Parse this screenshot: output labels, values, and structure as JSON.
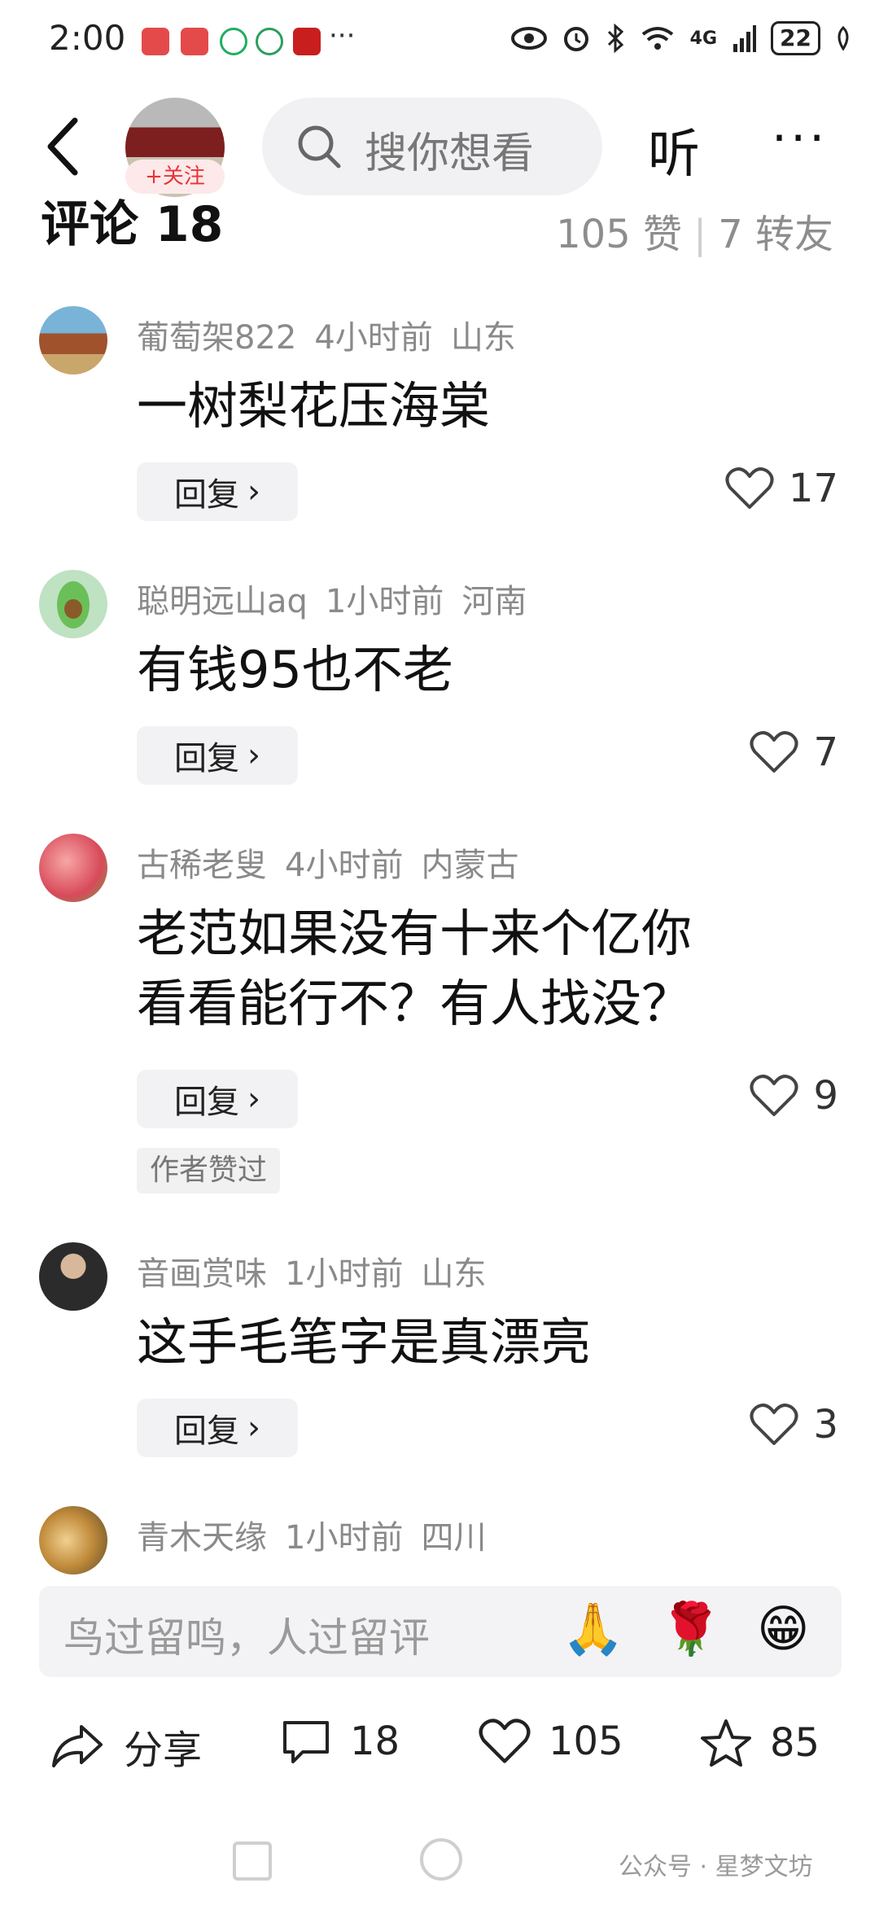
{
  "status_bar": {
    "time": "2:00",
    "network": "4G",
    "battery": "22",
    "icons": [
      "huawei-app-icon",
      "huawei-app-icon",
      "green-app-icon",
      "chat-app-icon",
      "study-app-icon",
      "more-dots-icon",
      "eye-icon",
      "alarm-icon",
      "bluetooth-icon",
      "wifi-icon",
      "signal-icon",
      "leaf-icon"
    ]
  },
  "top_nav": {
    "follow_label": "+关注",
    "search_placeholder": "搜你想看",
    "listen_label": "听",
    "more_label": "···"
  },
  "comments_header": {
    "title": "评论 18",
    "likes": "105 赞",
    "shares": "7 转友"
  },
  "comments": [
    {
      "user": "葡萄架822",
      "time": "4小时前",
      "location": "山东",
      "text": "一树梨花压海棠",
      "likes": "17",
      "reply": "回复"
    },
    {
      "user": "聪明远山aq",
      "time": "1小时前",
      "location": "河南",
      "text": "有钱95也不老",
      "likes": "7",
      "reply": "回复"
    },
    {
      "user": "古稀老叟",
      "time": "4小时前",
      "location": "内蒙古",
      "text_line1": "老范如果没有十来个亿你",
      "text_line2": "看看能行不？有人找没？",
      "likes": "9",
      "reply": "回复",
      "badge": "作者赞过"
    },
    {
      "user": "音画赏味",
      "time": "1小时前",
      "location": "山东",
      "text": "这手毛笔字是真漂亮",
      "likes": "3",
      "reply": "回复"
    },
    {
      "user": "青木天缘",
      "time": "1小时前",
      "location": "四川"
    }
  ],
  "input_bar": {
    "placeholder": "鸟过留鸣，人过留评",
    "emojis": [
      "🙏",
      "🌹",
      "😁"
    ]
  },
  "bottom_actions": {
    "share": "分享",
    "comments": "18",
    "likes": "105",
    "favorites": "85"
  },
  "watermark": "公众号 · 星梦文坊",
  "colors": {
    "accent_red": "#e8343a",
    "muted_gray": "#8a8a8a",
    "pill_bg": "#f2f2f4"
  }
}
